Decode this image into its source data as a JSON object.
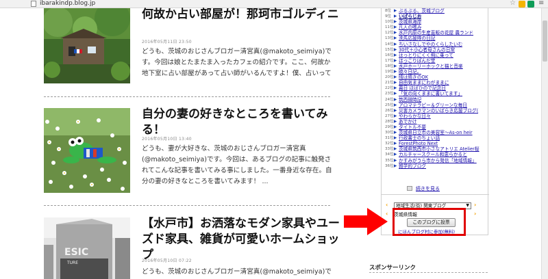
{
  "browser": {
    "url": "ibarakindp.blog.jp",
    "ext_colors": [
      "#f4b400",
      "#0f9d58",
      "#4285f4"
    ]
  },
  "posts": [
    {
      "title": "何故か占い部屋が！那珂市ゴルディニ",
      "date": "2016年05月11日 23:50",
      "excerpt": "どうも、茨城のおじさんブロガー清宮真(@makoto_seimiya)です。今回は娘とたまたま入ったカフェの紹介です。ここ、何故か地下室に占い部屋があって占い師がいるんですよ！僕、占いって信じ"
    },
    {
      "title": "自分の妻の好きなところを書いてみる！",
      "date": "2016年05月10日 13:40",
      "excerpt": "どうも、妻が大好きな、茨城のおじさんブロガー清宮真(@makoto_seimiya)です。今回は、あるブログの記事に触発されてこんな記事を書いてみる事にしました。一番身近な存在。自分の妻の好きなところを書いてみます！ ..."
    },
    {
      "title": "【水戸市】お洒落なモダン家具やユーズド家具、雑貨が可愛いホームショップ",
      "date": "2016年05月10日 07:22",
      "excerpt": "どうも、茨城のおじさんブロガー清宮真(@makoto_seimiya)です。"
    }
  ],
  "ranking": [
    {
      "num": "8位",
      "label": "ぶるぶる、茨城ブログ",
      "bold": false
    },
    {
      "num": "9位",
      "label": "いばらじお",
      "bold": true
    },
    {
      "num": "10位",
      "label": "茨城県海岸",
      "bold": false
    },
    {
      "num": "11位",
      "label": "凡人の嗜み",
      "bold": false
    },
    {
      "num": "12位",
      "label": "水戸内原の生産直販の花屋 農ランド",
      "bold": false
    },
    {
      "num": "13位",
      "label": "洗馬応援隊の日記",
      "bold": false
    },
    {
      "num": "14位",
      "label": "ちいさなしでやのくらしたいむ",
      "bold": false
    },
    {
      "num": "15位",
      "label": "30代＋小心者母さんの日常",
      "bold": false
    },
    {
      "num": "16位",
      "label": "はっとりにくく飛に乗って",
      "bold": false
    },
    {
      "num": "17位",
      "label": "ほっこりぽんだ堂",
      "bold": false
    },
    {
      "num": "18位",
      "label": "水戸ホーリーホックと猫と音楽",
      "bold": false
    },
    {
      "num": "19位",
      "label": "暁々日記。",
      "bold": false
    },
    {
      "num": "20位",
      "label": "晴は晴きのOK",
      "bold": false
    },
    {
      "num": "21位",
      "label": "自由気ままにわがままに",
      "bold": false
    },
    {
      "num": "22位",
      "label": "暮日 ほばひので記念日",
      "bold": false
    },
    {
      "num": "23位",
      "label": "「気の向くままに書いてます」",
      "bold": false
    },
    {
      "num": "24位",
      "label": "筑西微時記",
      "bold": false
    },
    {
      "num": "25位",
      "label": "アロマテラピー＆グリーンな毎日",
      "bold": false
    },
    {
      "num": "26位",
      "label": "災害カメラマンのいばらき応援ブログ(",
      "bold": false
    },
    {
      "num": "27位",
      "label": "やわらかな日々",
      "bold": false
    },
    {
      "num": "28位",
      "label": "あでかけ",
      "bold": false
    },
    {
      "num": "29位",
      "label": "タイトル不要",
      "bold": false
    },
    {
      "num": "30位",
      "label": "茨城県日立市の美容室〜As-on heir",
      "bold": false
    },
    {
      "num": "31位",
      "label": "行政書士のちょい話",
      "bold": false
    },
    {
      "num": "32位",
      "label": "ForestPhoto Next",
      "bold": false
    },
    {
      "num": "33位",
      "label": "茨城県筑西市小さなアトリエ Atelier桜",
      "bold": false
    },
    {
      "num": "34位",
      "label": "カルチャースクール和恵らかると",
      "bold": false
    },
    {
      "num": "35位",
      "label": "かすみがうら市から発信「地域情報」",
      "bold": false
    },
    {
      "num": "36位",
      "label": "雑学的ブログ",
      "bold": false
    }
  ],
  "sidebar": {
    "read_more": "続きを見る",
    "select_value": "地域生活(街) 関東ブログ",
    "region_label": "茨城県情報",
    "vote_button": "このブログに投票",
    "join_link": "にほんブログ村に参加(無料)",
    "sponsor_title": "スポンサーリンク"
  }
}
